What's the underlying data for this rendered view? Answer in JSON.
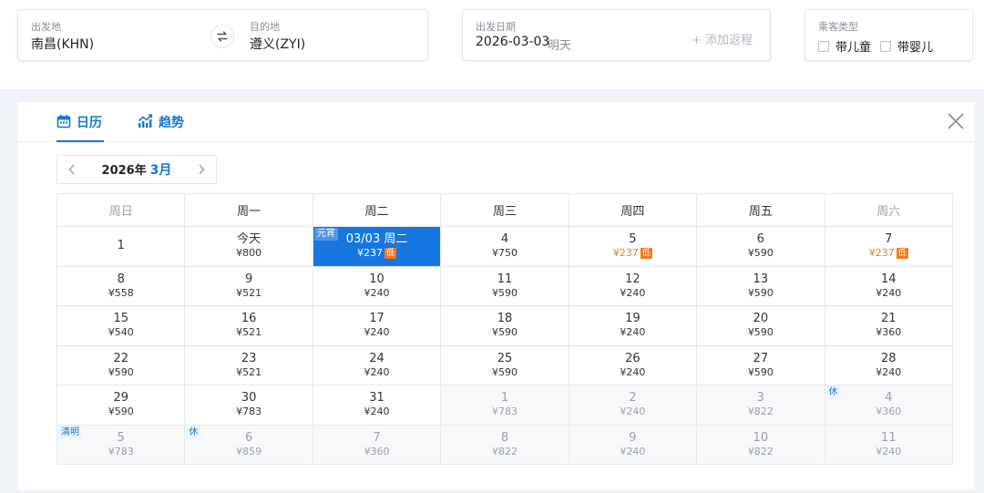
{
  "search": {
    "from_label": "出发地",
    "from_value": "南昌(KHN)",
    "to_label": "目的地",
    "to_value": "遵义(ZYI)",
    "date_label": "出发日期",
    "date_value": "2026-03-03",
    "date_hint": "明天",
    "add_return": "+ 添加返程",
    "passenger_label": "乘客类型",
    "with_child": "带儿童",
    "with_infant": "带婴儿"
  },
  "tabs": [
    {
      "label": "日历",
      "icon": "calendar-icon"
    },
    {
      "label": "趋势",
      "icon": "trend-chart-icon"
    }
  ],
  "nav": {
    "year": "2026年",
    "month": "3月"
  },
  "weekdays": [
    "周日",
    "周一",
    "周二",
    "周三",
    "周四",
    "周五",
    "周六"
  ],
  "weeks": [
    [
      {
        "day": "1",
        "price": ""
      },
      {
        "day": "今天",
        "price": "¥800"
      },
      {
        "day": "03/03 周二",
        "price": "¥237",
        "low": true,
        "selected": true,
        "badge": "元宵"
      },
      {
        "day": "4",
        "price": "¥750"
      },
      {
        "day": "5",
        "price": "¥237",
        "low": true
      },
      {
        "day": "6",
        "price": "¥590"
      },
      {
        "day": "7",
        "price": "¥237",
        "low": true
      }
    ],
    [
      {
        "day": "8",
        "price": "¥558"
      },
      {
        "day": "9",
        "price": "¥521"
      },
      {
        "day": "10",
        "price": "¥240"
      },
      {
        "day": "11",
        "price": "¥590"
      },
      {
        "day": "12",
        "price": "¥240"
      },
      {
        "day": "13",
        "price": "¥590"
      },
      {
        "day": "14",
        "price": "¥240"
      }
    ],
    [
      {
        "day": "15",
        "price": "¥540"
      },
      {
        "day": "16",
        "price": "¥521"
      },
      {
        "day": "17",
        "price": "¥240"
      },
      {
        "day": "18",
        "price": "¥590"
      },
      {
        "day": "19",
        "price": "¥240"
      },
      {
        "day": "20",
        "price": "¥590"
      },
      {
        "day": "21",
        "price": "¥360"
      }
    ],
    [
      {
        "day": "22",
        "price": "¥590"
      },
      {
        "day": "23",
        "price": "¥521"
      },
      {
        "day": "24",
        "price": "¥240"
      },
      {
        "day": "25",
        "price": "¥590"
      },
      {
        "day": "26",
        "price": "¥240"
      },
      {
        "day": "27",
        "price": "¥590"
      },
      {
        "day": "28",
        "price": "¥240"
      }
    ],
    [
      {
        "day": "29",
        "price": "¥590"
      },
      {
        "day": "30",
        "price": "¥783"
      },
      {
        "day": "31",
        "price": "¥240"
      },
      {
        "day": "1",
        "price": "¥783",
        "other": true
      },
      {
        "day": "2",
        "price": "¥240",
        "other": true
      },
      {
        "day": "3",
        "price": "¥822",
        "other": true
      },
      {
        "day": "4",
        "price": "¥360",
        "other": true,
        "badge": "休"
      }
    ],
    [
      {
        "day": "5",
        "price": "¥783",
        "other": true,
        "badge": "清明"
      },
      {
        "day": "6",
        "price": "¥859",
        "other": true,
        "badge": "休"
      },
      {
        "day": "7",
        "price": "¥360",
        "other": true
      },
      {
        "day": "8",
        "price": "¥822",
        "other": true
      },
      {
        "day": "9",
        "price": "¥240",
        "other": true
      },
      {
        "day": "10",
        "price": "¥822",
        "other": true
      },
      {
        "day": "11",
        "price": "¥240",
        "other": true
      }
    ]
  ],
  "low_tag": "低",
  "colors": {
    "accent": "#1677d2",
    "selected": "#1677e0",
    "low": "#f07820"
  }
}
